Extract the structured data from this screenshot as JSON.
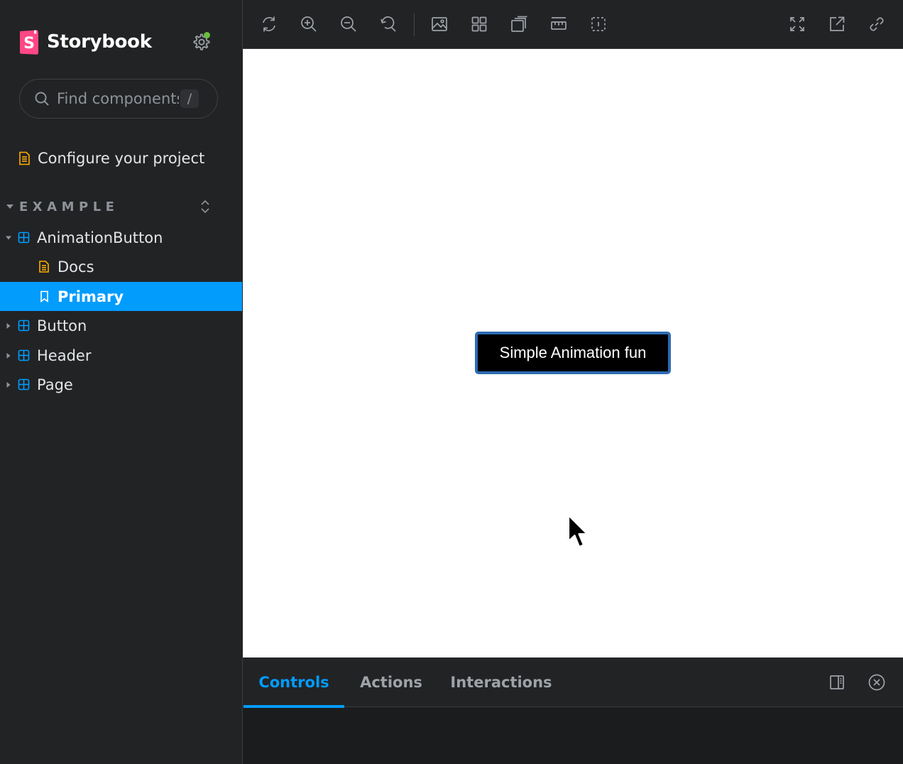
{
  "brand": {
    "name": "Storybook",
    "logo_letter": "S",
    "logo_color": "#ff4785"
  },
  "search": {
    "placeholder": "Find components",
    "shortcut": "/"
  },
  "sidebar": {
    "configure_label": "Configure your project",
    "section_label": "EXAMPLE",
    "items": [
      {
        "label": "AnimationButton",
        "icon": "component-icon",
        "expanded": true
      },
      {
        "label": "Docs",
        "icon": "document-icon"
      },
      {
        "label": "Primary",
        "icon": "bookmark-icon",
        "selected": true
      },
      {
        "label": "Button",
        "icon": "component-icon",
        "expanded": false
      },
      {
        "label": "Header",
        "icon": "component-icon",
        "expanded": false
      },
      {
        "label": "Page",
        "icon": "component-icon",
        "expanded": false
      }
    ]
  },
  "toolbar": {
    "tools": [
      "remount-icon",
      "zoom-in-icon",
      "zoom-out-icon",
      "zoom-reset-icon",
      "background-icon",
      "grid-icon",
      "viewport-icon",
      "measure-icon",
      "outline-icon"
    ],
    "right_tools": [
      "fullscreen-icon",
      "open-new-tab-icon",
      "copy-link-icon"
    ]
  },
  "canvas": {
    "button_label": "Simple Animation fun"
  },
  "panel": {
    "tabs": [
      {
        "label": "Controls",
        "active": true
      },
      {
        "label": "Actions"
      },
      {
        "label": "Interactions"
      }
    ]
  },
  "colors": {
    "accent": "#029cfd",
    "sidebar_bg": "#222325",
    "status_dot": "#66bf3c",
    "doc_icon": "#ffae00",
    "component_icon": "#029cfd"
  }
}
